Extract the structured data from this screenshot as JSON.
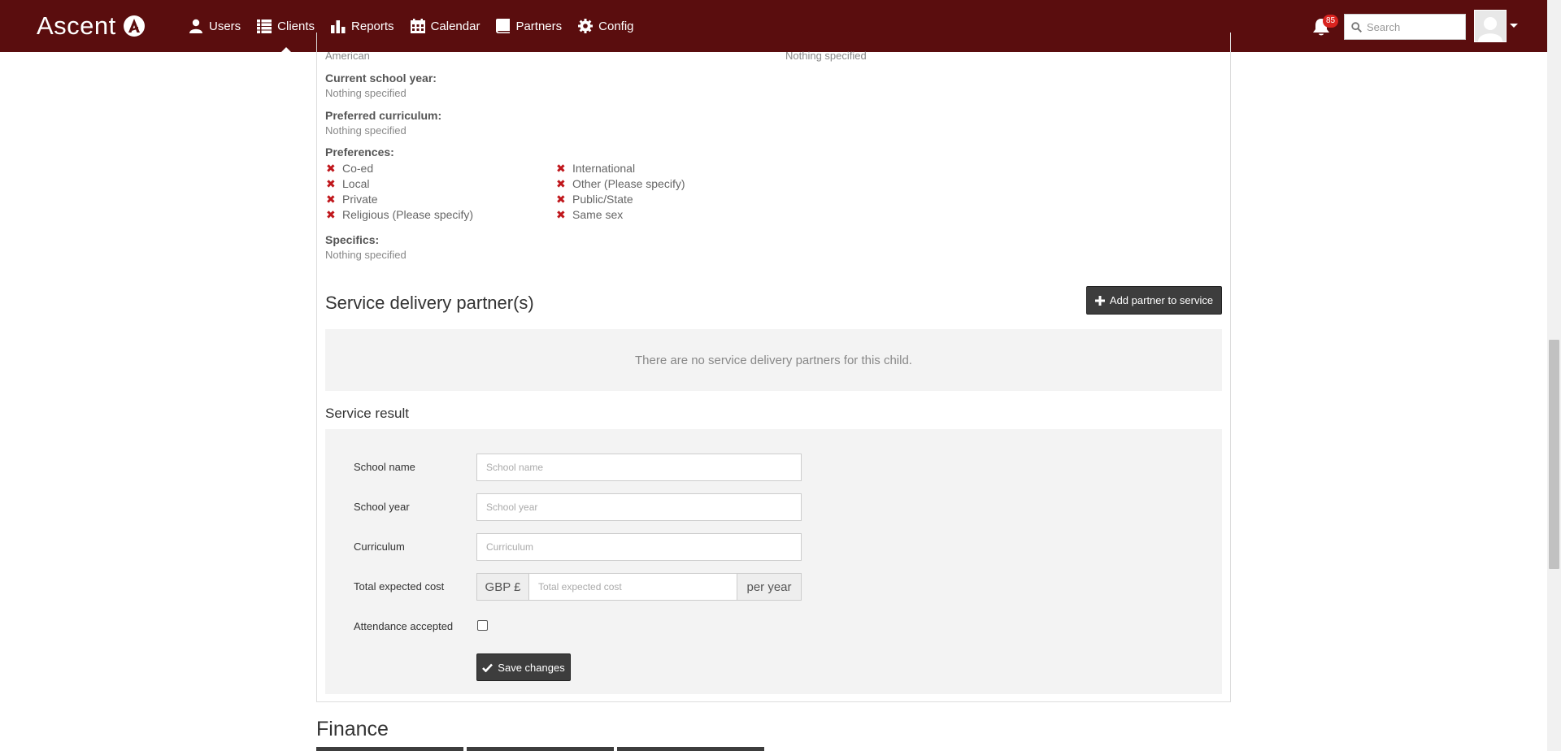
{
  "navbar": {
    "brand": "Ascent",
    "items": [
      {
        "label": "Users",
        "icon": "user-icon"
      },
      {
        "label": "Clients",
        "icon": "list-icon",
        "active": true
      },
      {
        "label": "Reports",
        "icon": "bar-chart-icon"
      },
      {
        "label": "Calendar",
        "icon": "calendar-icon"
      },
      {
        "label": "Partners",
        "icon": "book-icon"
      },
      {
        "label": "Config",
        "icon": "gear-icon"
      }
    ],
    "notifications_count": "85",
    "search_placeholder": "Search",
    "colors": {
      "bar": "#5a0d0e",
      "badge": "#d9241f"
    }
  },
  "details": {
    "nationality_value": "American",
    "right_column_value": "Nothing specified",
    "current_school_year_label": "Current school year:",
    "current_school_year_value": "Nothing specified",
    "preferred_curriculum_label": "Preferred curriculum:",
    "preferred_curriculum_value": "Nothing specified",
    "preferences_label": "Preferences:",
    "preferences_col1": [
      "Co-ed",
      "Local",
      "Private",
      "Religious (Please specify)"
    ],
    "preferences_col2": [
      "International",
      "Other (Please specify)",
      "Public/State",
      "Same sex"
    ],
    "specifics_label": "Specifics:",
    "specifics_value": "Nothing specified"
  },
  "service_delivery": {
    "title": "Service delivery partner(s)",
    "add_button_label": "Add partner to service",
    "empty_message": "There are no service delivery partners for this child."
  },
  "service_result": {
    "title": "Service result",
    "school_name_label": "School name",
    "school_name_placeholder": "School name",
    "school_year_label": "School year",
    "school_year_placeholder": "School year",
    "curriculum_label": "Curriculum",
    "curriculum_placeholder": "Curriculum",
    "cost_label": "Total expected cost",
    "cost_prefix": "GBP £",
    "cost_placeholder": "Total expected cost",
    "cost_suffix": "per year",
    "attendance_label": "Attendance accepted",
    "attendance_checked": false,
    "save_button_label": "Save changes"
  },
  "finance": {
    "title": "Finance"
  }
}
